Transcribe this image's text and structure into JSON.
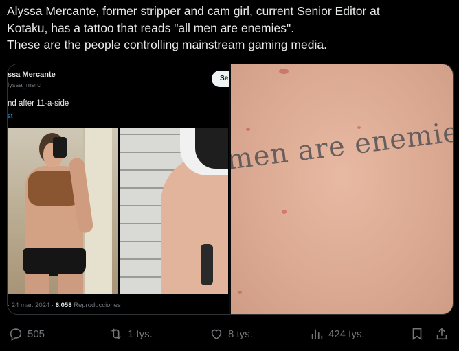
{
  "tweet": {
    "line1": "Alyssa Mercante, former stripper and cam girl, current Senior Editor at",
    "line2": "Kotaku, has a tattoo that reads \"all men are enemies\".",
    "line3": "These are the people controlling mainstream gaming media."
  },
  "embedded_tweet": {
    "name": "ssa Mercante",
    "handle": "lyssa_merc",
    "follow_label": "Se",
    "text": "nd after 11-a-side",
    "link": "st",
    "date": "· 24 mar. 2024 ·",
    "views_count": "6.058",
    "views_label": "Reproducciones"
  },
  "closeup_photo": {
    "tattoo_text": "men are enemies"
  },
  "actions": {
    "replies": "505",
    "retweets": "1 tys.",
    "likes": "8 tys.",
    "views": "424 tys."
  },
  "icons": [
    "reply-icon",
    "retweet-icon",
    "like-icon",
    "views-icon",
    "bookmark-icon",
    "share-icon"
  ],
  "colors": {
    "background": "#000000",
    "text": "#e7e9ea",
    "muted": "#71767b",
    "link": "#1d9bf0"
  }
}
